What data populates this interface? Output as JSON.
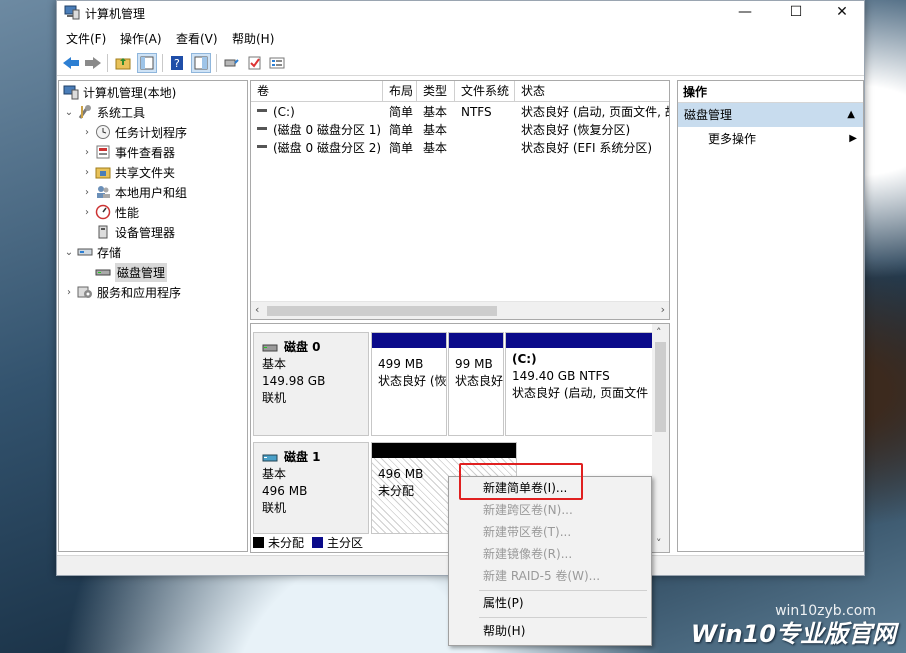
{
  "window": {
    "title": "计算机管理",
    "controls": {
      "minimize": "—",
      "maximize": "☐",
      "close": "✕"
    }
  },
  "menubar": [
    "文件(F)",
    "操作(A)",
    "查看(V)",
    "帮助(H)"
  ],
  "tree": {
    "root": "计算机管理(本地)",
    "system_tools": "系统工具",
    "system_children": [
      "任务计划程序",
      "事件查看器",
      "共享文件夹",
      "本地用户和组",
      "性能",
      "设备管理器"
    ],
    "storage": "存储",
    "disk_management": "磁盘管理",
    "services": "服务和应用程序"
  },
  "volumes": {
    "columns": [
      "卷",
      "布局",
      "类型",
      "文件系统",
      "状态"
    ],
    "rows": [
      {
        "name": "(C:)",
        "layout": "简单",
        "type": "基本",
        "fs": "NTFS",
        "status": "状态良好 (启动, 页面文件, 故"
      },
      {
        "name": "(磁盘 0 磁盘分区 1)",
        "layout": "简单",
        "type": "基本",
        "fs": "",
        "status": "状态良好 (恢复分区)"
      },
      {
        "name": "(磁盘 0 磁盘分区 2)",
        "layout": "简单",
        "type": "基本",
        "fs": "",
        "status": "状态良好 (EFI 系统分区)"
      }
    ]
  },
  "disks": [
    {
      "name": "磁盘 0",
      "type": "基本",
      "size": "149.98 GB",
      "status": "联机",
      "partitions": [
        {
          "title": "",
          "size": "499 MB",
          "status": "状态良好 (恢"
        },
        {
          "title": "",
          "size": "99 MB",
          "status": "状态良好"
        },
        {
          "title": "(C:)",
          "size": "149.40 GB NTFS",
          "status": "状态良好 (启动, 页面文件"
        }
      ]
    },
    {
      "name": "磁盘 1",
      "type": "基本",
      "size": "496 MB",
      "status": "联机",
      "partitions": [
        {
          "size": "496 MB",
          "status": "未分配"
        }
      ]
    }
  ],
  "legend": [
    {
      "label": "未分配",
      "color": "#000000"
    },
    {
      "label": "主分区",
      "color": "#0a0a8a"
    }
  ],
  "actions": {
    "header": "操作",
    "section": "磁盘管理",
    "more": "更多操作"
  },
  "context_menu": {
    "items": [
      {
        "label": "新建简单卷(I)...",
        "enabled": true
      },
      {
        "label": "新建跨区卷(N)...",
        "enabled": false
      },
      {
        "label": "新建带区卷(T)...",
        "enabled": false
      },
      {
        "label": "新建镜像卷(R)...",
        "enabled": false
      },
      {
        "label": "新建 RAID-5 卷(W)...",
        "enabled": false
      },
      {
        "label": "属性(P)",
        "enabled": true
      },
      {
        "label": "帮助(H)",
        "enabled": true
      }
    ]
  },
  "watermark": {
    "site": "win10zyb.com",
    "brand": "Win10专业版官网"
  },
  "icons": {
    "back": "back-arrow-icon",
    "forward": "forward-arrow-icon",
    "up": "up-folder-icon",
    "show_hide": "show-hide-tree-icon",
    "help": "help-icon",
    "properties": "properties-icon",
    "connect": "connect-icon",
    "check": "check-icon",
    "list": "list-icon"
  },
  "colors": {
    "primary_partition": "#0a0a8a",
    "unallocated": "#000000",
    "action_section": "#c8dcee",
    "highlight": "#e02020"
  }
}
